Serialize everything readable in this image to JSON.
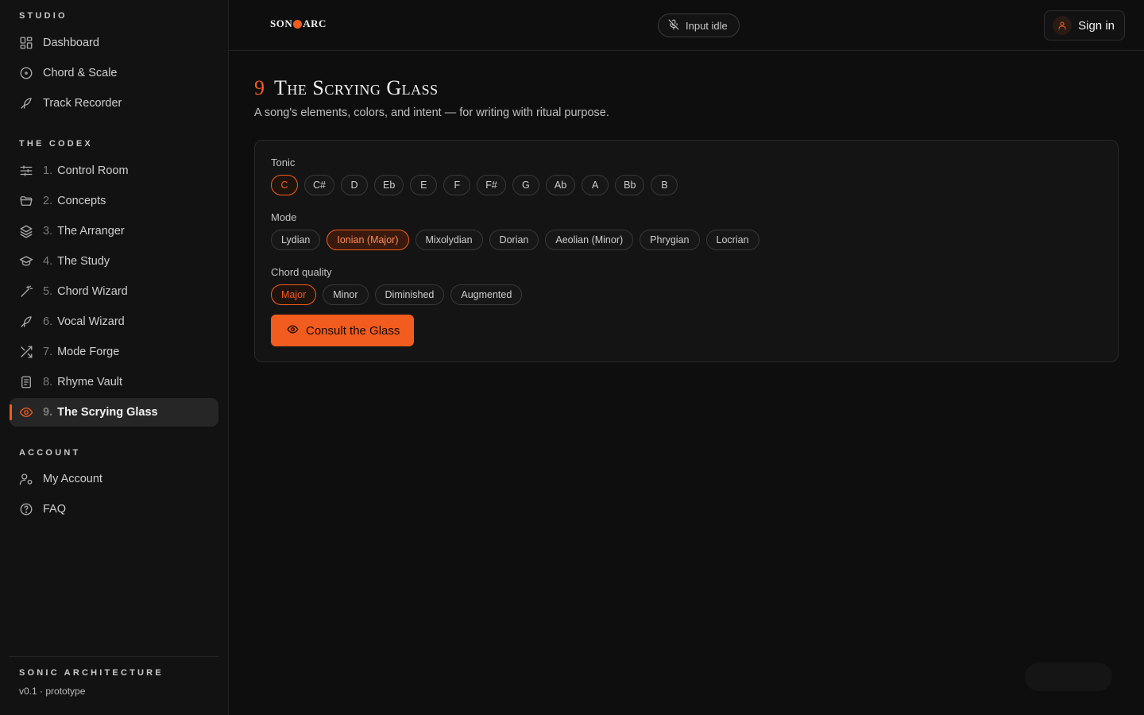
{
  "sidebar": {
    "studio_title": "STUDIO",
    "studio_items": [
      {
        "label": "Dashboard",
        "icon": "dashboard-grid-icon"
      },
      {
        "label": "Chord & Scale",
        "icon": "target-circle-icon"
      },
      {
        "label": "Track Recorder",
        "icon": "feather-pen-icon"
      }
    ],
    "codex_title": "THE CODEX",
    "codex_items": [
      {
        "num": "1.",
        "label": "Control Room",
        "icon": "sliders-icon"
      },
      {
        "num": "2.",
        "label": "Concepts",
        "icon": "folder-open-icon"
      },
      {
        "num": "3.",
        "label": "The Arranger",
        "icon": "layers-icon"
      },
      {
        "num": "4.",
        "label": "The Study",
        "icon": "graduation-cap-icon"
      },
      {
        "num": "5.",
        "label": "Chord Wizard",
        "icon": "magic-wand-icon"
      },
      {
        "num": "6.",
        "label": "Vocal Wizard",
        "icon": "feather-pen-icon"
      },
      {
        "num": "7.",
        "label": "Mode Forge",
        "icon": "shuffle-icon"
      },
      {
        "num": "8.",
        "label": "Rhyme Vault",
        "icon": "notebook-icon"
      },
      {
        "num": "9.",
        "label": "The Scrying Glass",
        "icon": "eye-icon"
      }
    ],
    "account_title": "ACCOUNT",
    "account_items": [
      {
        "label": "My Account",
        "icon": "user-settings-icon"
      },
      {
        "label": "FAQ",
        "icon": "help-circle-icon"
      }
    ],
    "footer_brand": "SONIC ARCHITECTURE",
    "footer_version": "v0.1 · prototype"
  },
  "topbar": {
    "logo_left": "SON",
    "logo_right": "ARC",
    "input_status": "Input idle",
    "signin_label": "Sign in"
  },
  "page": {
    "number": "9",
    "title": "The Scrying Glass",
    "subtitle": "A song's elements, colors, and intent — for writing with ritual purpose."
  },
  "form": {
    "tonic_label": "Tonic",
    "tonics": [
      "C",
      "C#",
      "D",
      "Eb",
      "E",
      "F",
      "F#",
      "G",
      "Ab",
      "A",
      "Bb",
      "B"
    ],
    "tonic_selected": "C",
    "mode_label": "Mode",
    "modes": [
      "Lydian",
      "Ionian (Major)",
      "Mixolydian",
      "Dorian",
      "Aeolian (Minor)",
      "Phrygian",
      "Locrian"
    ],
    "mode_selected": "Ionian (Major)",
    "quality_label": "Chord quality",
    "qualities": [
      "Major",
      "Minor",
      "Diminished",
      "Augmented"
    ],
    "quality_selected": "Major",
    "consult_label": "Consult the Glass"
  },
  "colors": {
    "accent": "#f25c1e",
    "background": "#0e0e0e",
    "sidebar_bg": "#121212"
  }
}
